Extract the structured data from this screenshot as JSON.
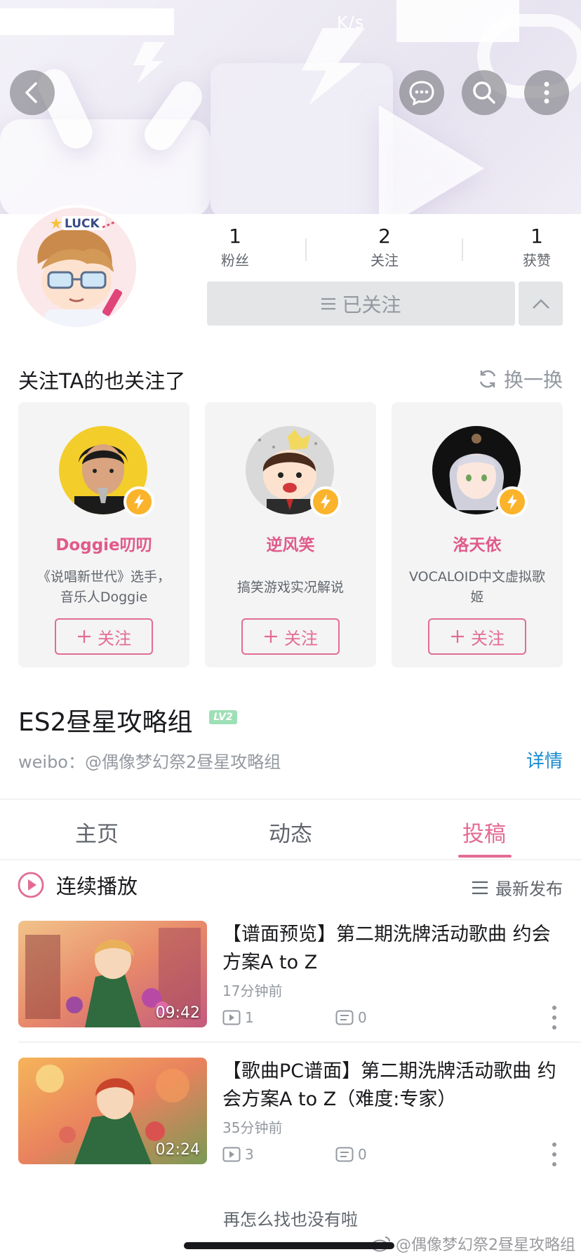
{
  "status_bar": {
    "speed": "K/s"
  },
  "header_buttons": {
    "back": "back-icon",
    "message": "message-icon",
    "search": "search-icon",
    "more": "more-vertical-icon"
  },
  "profile": {
    "avatar_text": "LUCK",
    "stats": [
      {
        "value": "1",
        "label": "粉丝"
      },
      {
        "value": "2",
        "label": "关注"
      },
      {
        "value": "1",
        "label": "获赞"
      }
    ],
    "follow_state": "已关注"
  },
  "recommend": {
    "title": "关注TA的也关注了",
    "refresh": "换一换",
    "users": [
      {
        "name": "Doggie叨叨",
        "desc": "《说唱新世代》选手，音乐人Doggie",
        "follow": "关注"
      },
      {
        "name": "逆风笑",
        "desc": "搞笑游戏实况解说",
        "follow": "关注"
      },
      {
        "name": "洛天依",
        "desc": "VOCALOID中文虚拟歌姬",
        "follow": "关注"
      }
    ]
  },
  "user": {
    "name": "ES2昼星攻略组",
    "level": "LV2",
    "bio": "weibo：@偶像梦幻祭2昼星攻略组",
    "detail": "详情"
  },
  "tabs": [
    {
      "label": "主页",
      "active": false
    },
    {
      "label": "动态",
      "active": false
    },
    {
      "label": "投稿",
      "active": true
    }
  ],
  "playlist": {
    "play_all": "连续播放",
    "sort": "最新发布"
  },
  "videos": [
    {
      "title": "【谱面预览】第二期洗牌活动歌曲 约会方案A to Z",
      "time": "17分钟前",
      "duration": "09:42",
      "plays": "1",
      "comments": "0"
    },
    {
      "title": "【歌曲PC谱面】第二期洗牌活动歌曲 约会方案A to Z（难度:专家）",
      "time": "35分钟前",
      "duration": "02:24",
      "plays": "3",
      "comments": "0"
    }
  ],
  "footer": {
    "end_text": "再怎么找也没有啦",
    "watermark": "@偶像梦幻祭2昼星攻略组"
  },
  "colors": {
    "accent_pink": "#e36c94",
    "link_blue": "#178bcf",
    "level_green": "#9ee0b6",
    "badge_yellow": "#fbb32b"
  }
}
